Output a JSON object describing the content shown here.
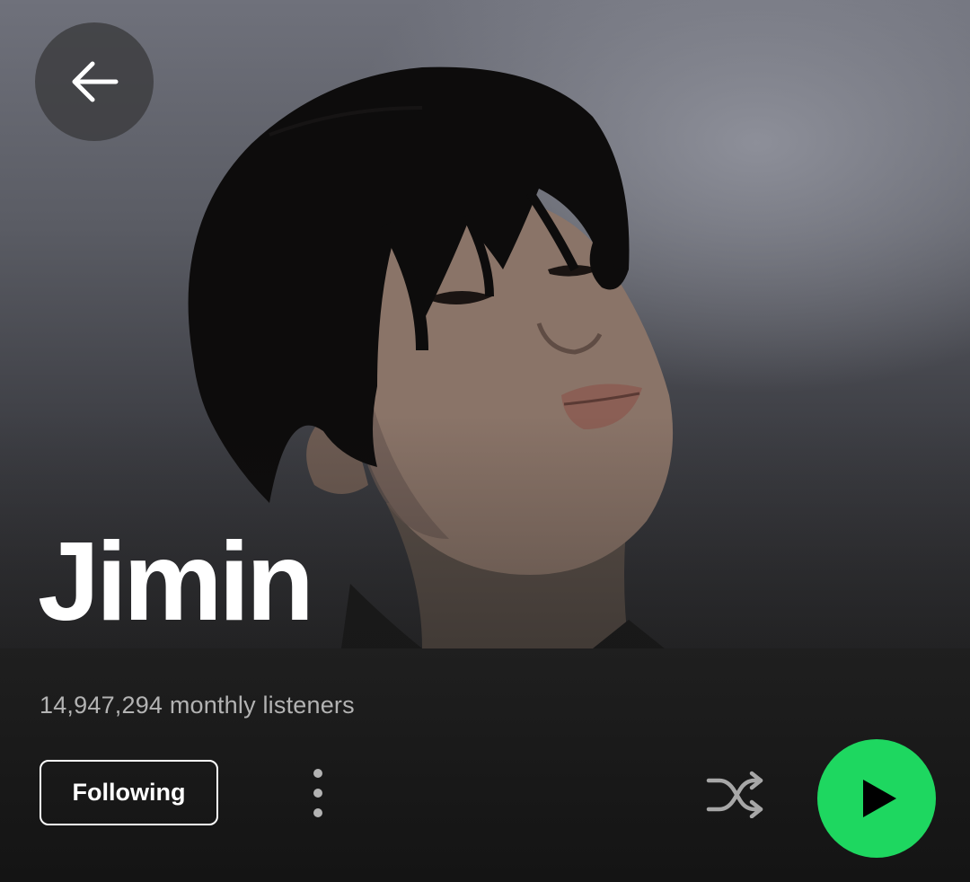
{
  "artist": {
    "name": "Jimin",
    "monthly_listeners": "14,947,294 monthly listeners"
  },
  "actions": {
    "follow_label": "Following"
  },
  "icons": {
    "back": "arrow-left-icon",
    "more": "more-vertical-icon",
    "shuffle": "shuffle-icon",
    "play": "play-icon"
  },
  "colors": {
    "accent": "#1ed760",
    "text_primary": "#ffffff",
    "text_secondary": "#b3b3b3",
    "background": "#181818"
  }
}
